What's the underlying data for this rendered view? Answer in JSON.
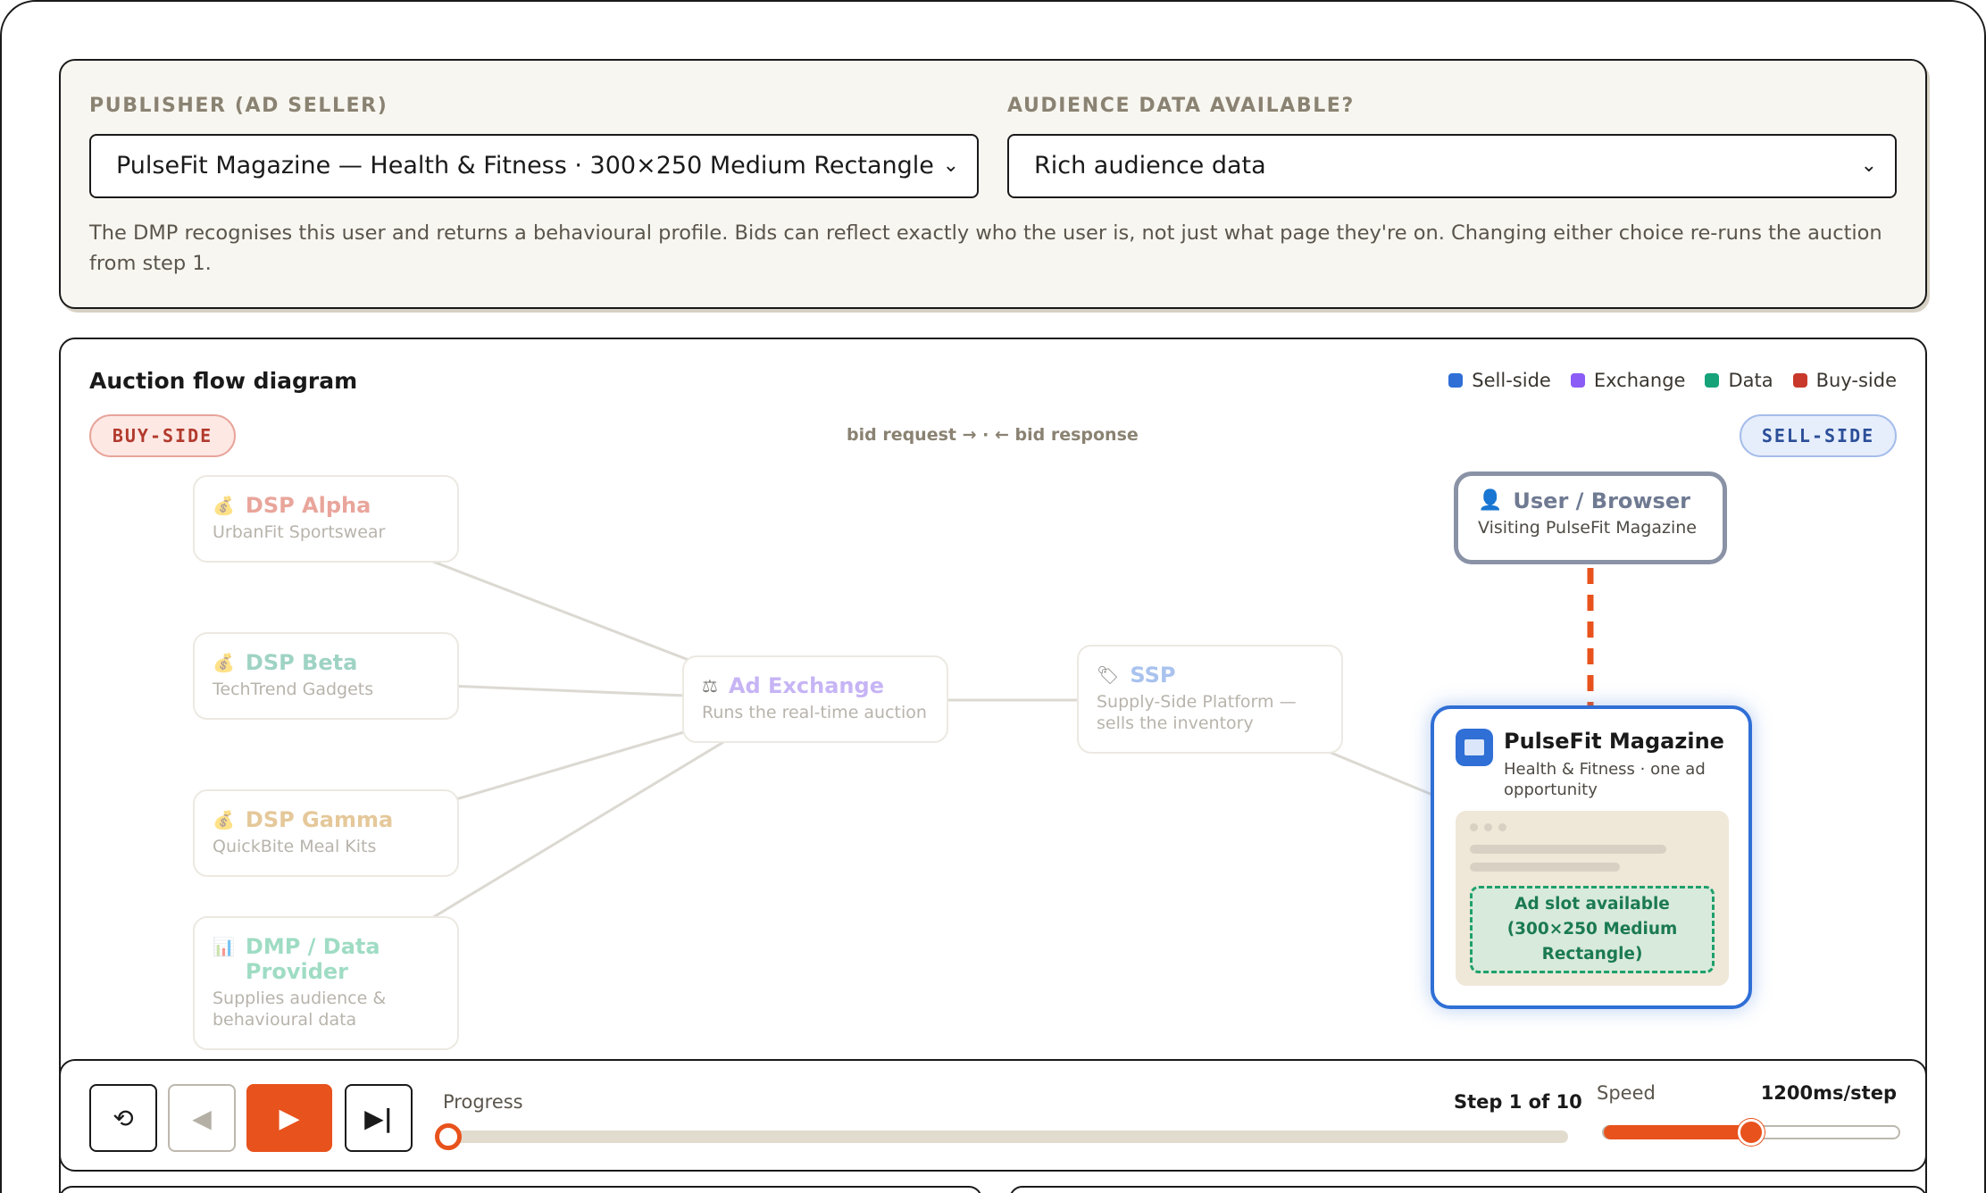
{
  "controls": {
    "publisher_label": "PUBLISHER (AD SELLER)",
    "publisher_value": "PulseFit Magazine — Health & Fitness · 300×250 Medium Rectangle",
    "audience_label": "AUDIENCE DATA AVAILABLE?",
    "audience_value": "Rich audience data",
    "description": "The DMP recognises this user and returns a behavioural profile. Bids can reflect exactly who the user is, not just what page they're on. Changing either choice re-runs the auction from step 1."
  },
  "diagram": {
    "title": "Auction flow diagram",
    "legend": [
      {
        "label": "Sell-side",
        "color": "#2f6fd6"
      },
      {
        "label": "Exchange",
        "color": "#8b5cf6"
      },
      {
        "label": "Data",
        "color": "#16a37a"
      },
      {
        "label": "Buy-side",
        "color": "#c8392b"
      }
    ],
    "buy_side_label": "BUY-SIDE",
    "sell_side_label": "SELL-SIDE",
    "flow_hint": "bid request → · ← bid response",
    "nodes": {
      "dsp_alpha": {
        "title": "DSP Alpha",
        "sub": "UrbanFit Sportswear",
        "icon": "money-bag-icon",
        "color": "#e9a59b"
      },
      "dsp_beta": {
        "title": "DSP Beta",
        "sub": "TechTrend Gadgets",
        "icon": "money-bag-icon",
        "color": "#9fd3c4"
      },
      "dsp_gamma": {
        "title": "DSP Gamma",
        "sub": "QuickBite Meal Kits",
        "icon": "money-bag-icon",
        "color": "#e5c89a"
      },
      "dmp": {
        "title": "DMP / Data Provider",
        "sub": "Supplies audience & behavioural data",
        "icon": "bar-chart-icon",
        "color": "#9fdcc4"
      },
      "exchange": {
        "title": "Ad Exchange",
        "sub": "Runs the real-time auction",
        "icon": "scales-icon",
        "color": "#c6b4f5"
      },
      "ssp": {
        "title": "SSP",
        "sub": "Supply-Side Platform — sells the inventory",
        "icon": "tag-icon",
        "color": "#a9c2ee"
      },
      "user": {
        "title": "User / Browser",
        "sub": "Visiting PulseFit Magazine",
        "icon": "user-icon"
      },
      "publisher": {
        "title": "PulseFit Magazine",
        "sub": "Health & Fitness · one ad opportunity",
        "ad_slot": "Ad slot available (300×250 Medium Rectangle)",
        "icon": "newspaper-icon"
      }
    }
  },
  "player": {
    "progress_label": "Progress",
    "step_label": "Step 1 of 10",
    "progress_fraction": 0.0,
    "speed_label": "Speed",
    "speed_value": "1200ms/step",
    "speed_fraction": 0.5
  }
}
